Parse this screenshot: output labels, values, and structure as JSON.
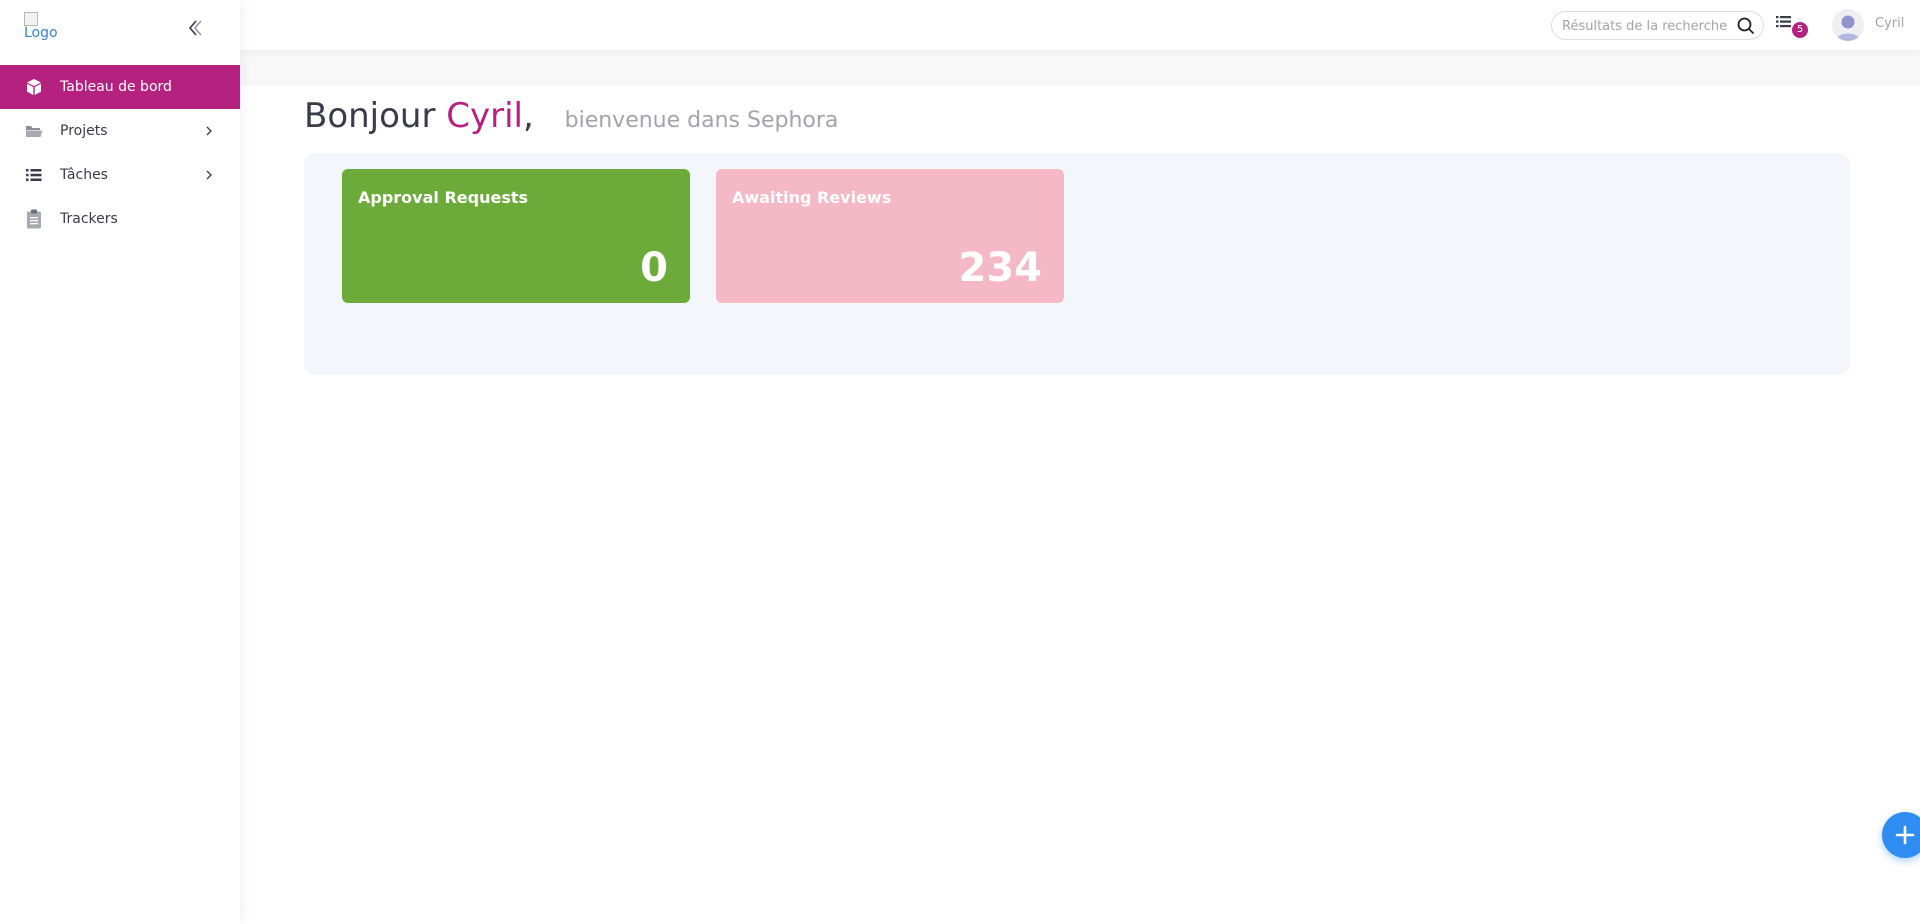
{
  "sidebar": {
    "logo_alt": "Logo",
    "items": [
      {
        "label": "Tableau de bord",
        "icon": "cube-icon",
        "active": true
      },
      {
        "label": "Projets",
        "icon": "folder-icon",
        "has_children": true
      },
      {
        "label": "Tâches",
        "icon": "list-icon",
        "has_children": true
      },
      {
        "label": "Trackers",
        "icon": "clipboard-icon"
      }
    ]
  },
  "topbar": {
    "search_placeholder": "Résultats de la recherche",
    "tasks_badge": "5",
    "user_name": "Cyril"
  },
  "main": {
    "greeting_prefix": "Bonjour",
    "greeting_name": "Cyril",
    "greeting_comma": ",",
    "welcome": "bienvenue dans Sephora",
    "cards": [
      {
        "title": "Approval Requests",
        "value": "0",
        "color": "#6cab3a"
      },
      {
        "title": "Awaiting Reviews",
        "value": "234",
        "color": "#f5b8c6"
      }
    ]
  },
  "colors": {
    "accent": "#b5217e",
    "fab": "#2f8cf0"
  }
}
